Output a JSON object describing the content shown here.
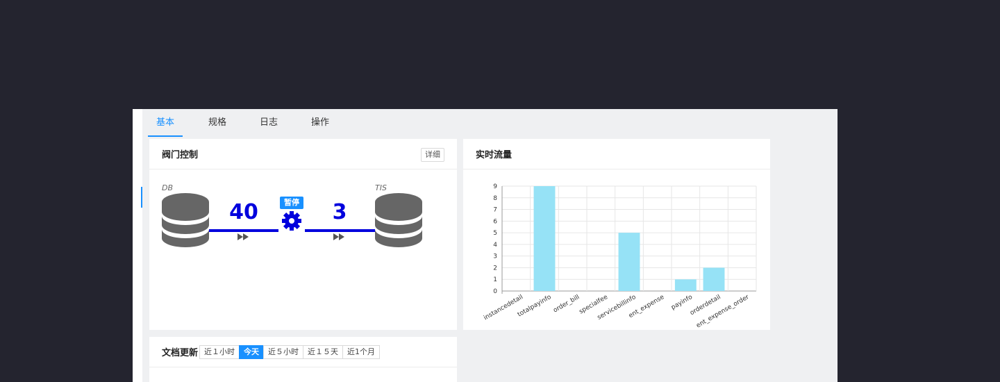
{
  "tabs": [
    {
      "label": "基本",
      "active": true
    },
    {
      "label": "规格",
      "active": false
    },
    {
      "label": "日志",
      "active": false
    },
    {
      "label": "操作",
      "active": false
    }
  ],
  "valve_card": {
    "title": "阀门控制",
    "detail_label": "详细",
    "source_label": "DB",
    "target_label": "TIS",
    "left_count": "40",
    "right_count": "3",
    "pause_label": "暂停"
  },
  "traffic_card": {
    "title": "实时流量"
  },
  "doc_card": {
    "title": "文档更新",
    "ranges": [
      {
        "label": "近１小时",
        "active": false
      },
      {
        "label": "今天",
        "active": true
      },
      {
        "label": "近５小时",
        "active": false
      },
      {
        "label": "近１５天",
        "active": false
      },
      {
        "label": "近1个月",
        "active": false
      }
    ]
  },
  "colors": {
    "accent": "#1890ff",
    "flow": "#0000dd",
    "bar": "#96e2f6",
    "db": "#666666"
  },
  "chart_data": {
    "type": "bar",
    "categories": [
      "instancedetail",
      "totalpayinfo",
      "order_bill",
      "specialfee",
      "servicebillinfo",
      "ent_expense",
      "payinfo",
      "orderdetail",
      "ent_expense_order"
    ],
    "values": [
      0,
      9,
      0,
      0,
      5,
      0,
      1,
      2,
      0
    ],
    "ylim": [
      0,
      9
    ],
    "yticks": [
      0,
      1,
      2,
      3,
      4,
      5,
      6,
      7,
      8,
      9
    ],
    "grid": true
  }
}
